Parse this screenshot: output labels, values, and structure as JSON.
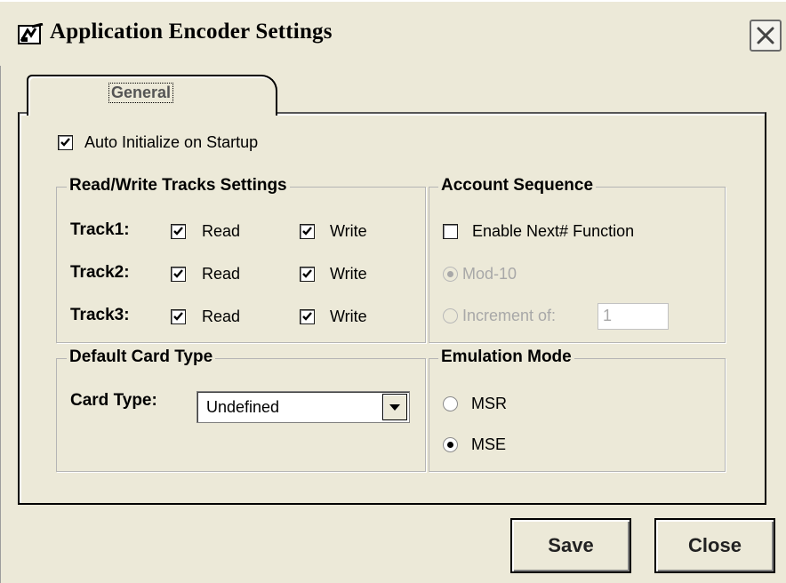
{
  "window": {
    "title": "Application Encoder Settings",
    "icon": "encoder-app-icon",
    "close_icon": "close-icon"
  },
  "tabs": [
    {
      "label": "General",
      "active": true
    }
  ],
  "general": {
    "auto_init": {
      "label": "Auto Initialize on Startup",
      "checked": true
    }
  },
  "tracks_group": {
    "title": "Read/Write Tracks Settings",
    "rows": [
      {
        "label": "Track1:",
        "read_label": "Read",
        "read": true,
        "write_label": "Write",
        "write": true
      },
      {
        "label": "Track2:",
        "read_label": "Read",
        "read": true,
        "write_label": "Write",
        "write": true
      },
      {
        "label": "Track3:",
        "read_label": "Read",
        "read": true,
        "write_label": "Write",
        "write": true
      }
    ]
  },
  "account_group": {
    "title": "Account Sequence",
    "enable_next": {
      "label": "Enable Next# Function",
      "checked": false
    },
    "mod10": {
      "label": "Mod-10",
      "selected": true,
      "enabled": false
    },
    "increment": {
      "label": "Increment of:",
      "selected": false,
      "enabled": false,
      "value": "1"
    }
  },
  "card_group": {
    "title": "Default Card Type",
    "card_type_label": "Card Type:",
    "card_type_value": "Undefined"
  },
  "emulation_group": {
    "title": "Emulation Mode",
    "options": [
      {
        "label": "MSR",
        "selected": false
      },
      {
        "label": "MSE",
        "selected": true
      }
    ]
  },
  "buttons": {
    "save": "Save",
    "close": "Close"
  }
}
